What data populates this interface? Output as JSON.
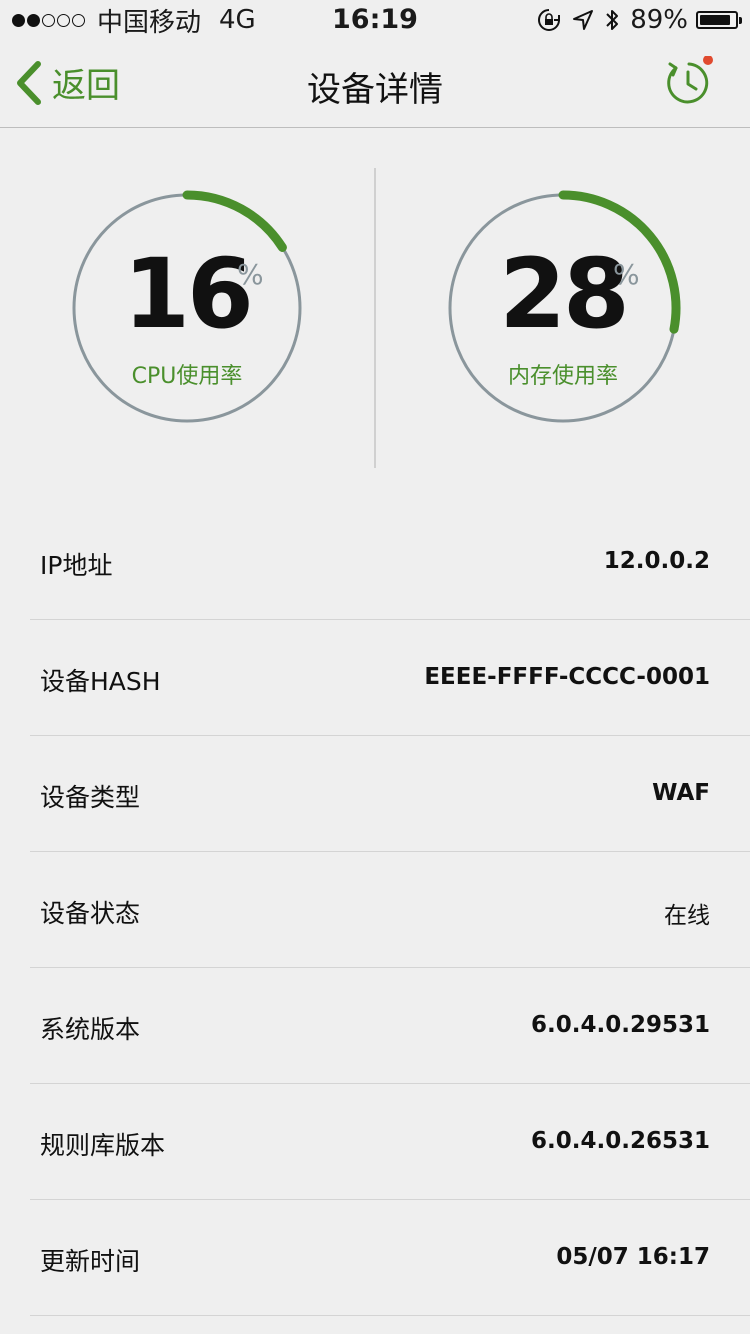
{
  "status_bar": {
    "carrier": "中国移动",
    "network": "4G",
    "time": "16:19",
    "battery_percent": "89%",
    "battery_level": 0.89,
    "signal_dots_filled": 2,
    "signal_dots_total": 5,
    "icons": [
      "rotation-lock-icon",
      "location-arrow-icon",
      "bluetooth-icon",
      "battery-icon"
    ]
  },
  "nav": {
    "back_label": "返回",
    "title": "设备详情",
    "history_icon": "history-clock-icon",
    "notification_dot_color": "#e04a2f"
  },
  "gauges": {
    "cpu": {
      "value": "16",
      "value_num": 16,
      "unit": "%",
      "label": "CPU使用率"
    },
    "memory": {
      "value": "28",
      "value_num": 28,
      "unit": "%",
      "label": "内存使用率"
    }
  },
  "info": {
    "rows": [
      {
        "label": "IP地址",
        "value": "12.0.0.2"
      },
      {
        "label": "设备HASH",
        "value": "EEEE-FFFF-CCCC-0001"
      },
      {
        "label": "设备类型",
        "value": "WAF"
      },
      {
        "label": "设备状态",
        "value": "在线"
      },
      {
        "label": "系统版本",
        "value": "6.0.4.0.29531"
      },
      {
        "label": "规则库版本",
        "value": "6.0.4.0.26531"
      },
      {
        "label": "更新时间",
        "value": "05/07 16:17"
      }
    ]
  },
  "colors": {
    "accent_green": "#4a8f2c",
    "gauge_track": "#8a969c",
    "background": "#efefef"
  }
}
